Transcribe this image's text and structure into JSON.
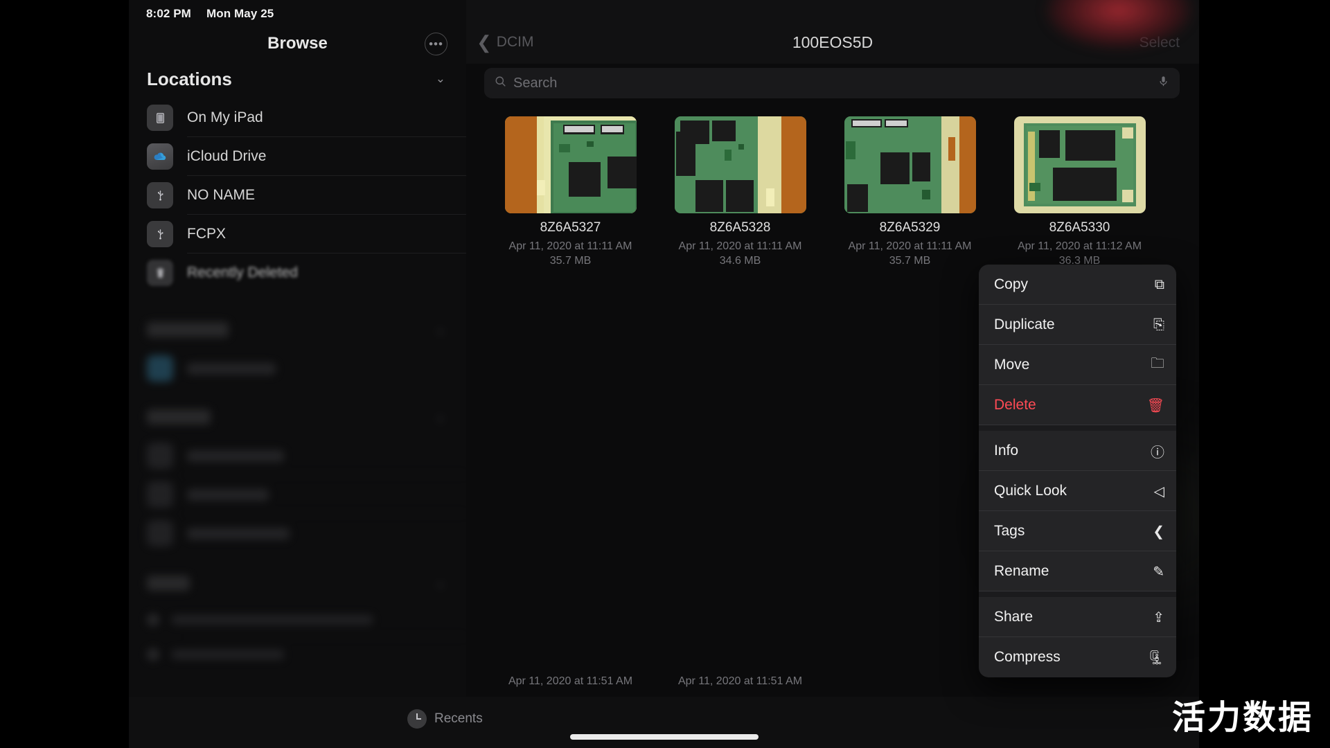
{
  "status_bar": {
    "time": "8:02 PM",
    "date": "Mon May 25"
  },
  "sidebar": {
    "title": "Browse",
    "more_icon": "•••",
    "sections": [
      {
        "id": "locations",
        "title": "Locations",
        "chevron": "⌄",
        "items": [
          {
            "label": "On My iPad",
            "icon": "ipad-icon"
          },
          {
            "label": "iCloud Drive",
            "icon": "cloud-icon"
          },
          {
            "label": "NO NAME",
            "icon": "usb-icon"
          },
          {
            "label": "FCPX",
            "icon": "usb-icon"
          },
          {
            "label": "Recently Deleted",
            "icon": "trash-icon"
          }
        ]
      },
      {
        "id": "favorites",
        "title": "Favorites",
        "chevron": "⌄",
        "items": [
          {
            "label": "Downloads",
            "icon": "folder-icon"
          }
        ]
      },
      {
        "id": "shared",
        "title": "Shared",
        "chevron": "⌄",
        "items": [
          {
            "label": "Shared item 1",
            "icon": "folder-icon"
          },
          {
            "label": "Shared item 2",
            "icon": "folder-icon"
          },
          {
            "label": "Shared item 3",
            "icon": "folder-icon"
          }
        ]
      },
      {
        "id": "tags",
        "title": "Tags",
        "chevron": "⌄",
        "items": [
          {
            "label": "Tag item one",
            "icon": "tag-icon"
          },
          {
            "label": "Tag item two",
            "icon": "tag-icon"
          }
        ]
      }
    ]
  },
  "main": {
    "back_label": "DCIM",
    "back_chevron": "❮",
    "folder_title": "100EOS5D",
    "select_label": "Select",
    "search": {
      "placeholder": "Search",
      "value": "",
      "icon": "search-icon",
      "mic_icon": "mic-icon"
    },
    "files": [
      {
        "name": "8Z6A5327",
        "date": "Apr 11, 2020 at 11:11 AM",
        "size": "35.7 MB"
      },
      {
        "name": "8Z6A5328",
        "date": "Apr 11, 2020 at 11:11 AM",
        "size": "34.6 MB"
      },
      {
        "name": "8Z6A5329",
        "date": "Apr 11, 2020 at 11:11 AM",
        "size": "35.7 MB"
      },
      {
        "name": "8Z6A5330",
        "date": "Apr 11, 2020 at 11:12 AM",
        "size": "36.3 MB"
      }
    ],
    "second_row_meta": [
      "Apr 11, 2020 at 11:51 AM",
      "Apr 11, 2020 at 11:51 AM",
      "",
      ""
    ]
  },
  "context_menu": {
    "items": [
      {
        "label": "Copy",
        "glyph": "⧉",
        "destructive": false,
        "sep_after": false
      },
      {
        "label": "Duplicate",
        "glyph": "⎘",
        "destructive": false,
        "sep_after": false
      },
      {
        "label": "Move",
        "glyph": "🗀",
        "destructive": false,
        "sep_after": false
      },
      {
        "label": "Delete",
        "glyph": "🗑",
        "destructive": true,
        "sep_after": true
      },
      {
        "label": "Info",
        "glyph": "ⓘ",
        "destructive": false,
        "sep_after": false
      },
      {
        "label": "Quick Look",
        "glyph": "◁",
        "destructive": false,
        "sep_after": false
      },
      {
        "label": "Tags",
        "glyph": "❮",
        "destructive": false,
        "sep_after": false
      },
      {
        "label": "Rename",
        "glyph": "✎",
        "destructive": false,
        "sep_after": true
      },
      {
        "label": "Share",
        "glyph": "⇪",
        "destructive": false,
        "sep_after": false
      },
      {
        "label": "Compress",
        "glyph": "🗜",
        "destructive": false,
        "sep_after": false
      }
    ]
  },
  "bottom_bar": {
    "recents_label": "Recents",
    "recents_icon": "clock-icon"
  },
  "watermark": {
    "text": "活力数据"
  },
  "colors": {
    "destructive": "#ff4b55",
    "menu_bg": "#242426",
    "sidebar_bg": "#0d0d0e",
    "main_bg": "#0b0b0c",
    "text_primary": "#f2f2f2",
    "text_secondary": "#77777c"
  }
}
